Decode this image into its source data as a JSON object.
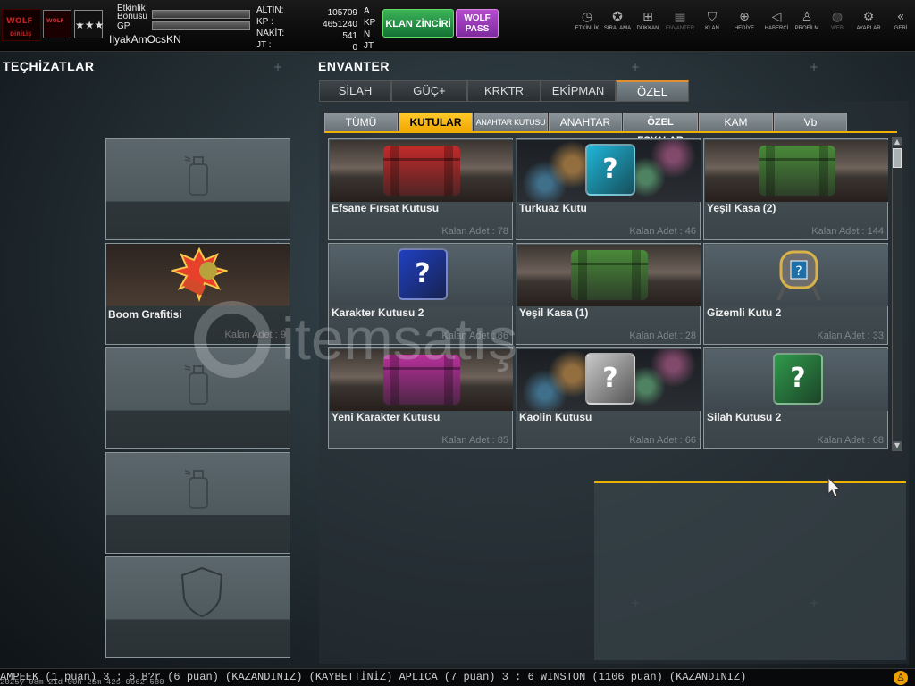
{
  "topbar": {
    "logo_text": "WOLF",
    "logo_sub": "DİRİLİŞ",
    "badge_text": "WOLF",
    "rank_glyph": "★★★",
    "event_bonus_label_1": "Etkinlik",
    "event_bonus_label_2": "Bonusu",
    "gp_label": "GP",
    "username": "IlyakAmOcsKN",
    "currencies": [
      {
        "label": "ALTIN:",
        "value": "105709",
        "unit": "A"
      },
      {
        "label": "KP  :",
        "value": "4651240",
        "unit": "KP"
      },
      {
        "label": "NAKİT:",
        "value": "541",
        "unit": "N"
      },
      {
        "label": "JT  :",
        "value": "0",
        "unit": "JT"
      }
    ],
    "klan_button": "KLAN ZİNCİRİ",
    "wolf_pass_line1": "WOLF",
    "wolf_pass_line2": "PASS",
    "nav": [
      {
        "label": "ETKİNLİK",
        "icon": "clock-icon",
        "glyph": "◷"
      },
      {
        "label": "SIRALAMA",
        "icon": "medal-icon",
        "glyph": "✪"
      },
      {
        "label": "DÜKKAN",
        "icon": "cart-icon",
        "glyph": "⊞"
      },
      {
        "label": "ENVANTER",
        "icon": "inventory-icon",
        "glyph": "▦"
      },
      {
        "label": "KLAN",
        "icon": "shield-icon",
        "glyph": "⛉"
      },
      {
        "label": "HEDİYE",
        "icon": "gift-icon",
        "glyph": "⊕"
      },
      {
        "label": "HABERCİ",
        "icon": "megaphone-icon",
        "glyph": "◁"
      },
      {
        "label": "PROFİLM",
        "icon": "profile-icon",
        "glyph": "♙"
      },
      {
        "label": "WEB",
        "icon": "globe-icon",
        "glyph": "◍"
      },
      {
        "label": "AYARLAR",
        "icon": "gear-icon",
        "glyph": "⚙"
      },
      {
        "label": "GERİ",
        "icon": "back-icon",
        "glyph": "«"
      }
    ]
  },
  "equipment": {
    "title": "TEÇHİZATLAR",
    "slots": [
      {
        "name": "",
        "count": "",
        "icon": "spray-can-icon"
      },
      {
        "name": "Boom Grafitisi",
        "count": "Kalan Adet : 9",
        "icon": "boom-graffiti-icon"
      },
      {
        "name": "",
        "count": "",
        "icon": "spray-can-icon"
      },
      {
        "name": "",
        "count": "",
        "icon": "spray-can-icon"
      },
      {
        "name": "",
        "count": "",
        "icon": "shield-icon"
      }
    ]
  },
  "inventory": {
    "title": "ENVANTER",
    "main_tabs": [
      "SİLAH",
      "GÜÇ+",
      "KRKTR",
      "EKİPMAN",
      "ÖZEL"
    ],
    "active_main_tab": "ÖZEL",
    "sub_tabs": [
      "TÜMÜ",
      "KUTULAR",
      "ANAHTAR KUTUSU",
      "ANAHTAR",
      "ÖZEL EŞYALAR",
      "KAM",
      "Vb"
    ],
    "active_sub_tab": "KUTULAR",
    "items": [
      {
        "name": "Efsane Fırsat Kutusu",
        "count": "Kalan Adet : 78",
        "icon": "red-crate-icon",
        "color": "#c42a2a"
      },
      {
        "name": "Turkuaz Kutu",
        "count": "Kalan Adet : 46",
        "icon": "turquoise-box-icon",
        "color": "#1fb6d8"
      },
      {
        "name": "Yeşil Kasa (2)",
        "count": "Kalan Adet : 144",
        "icon": "green-crate-icon",
        "color": "#4a8a3a"
      },
      {
        "name": "Karakter Kutusu 2",
        "count": "Kalan Adet : 86",
        "icon": "blue-character-box-icon",
        "color": "#2040c0"
      },
      {
        "name": "Yeşil Kasa (1)",
        "count": "Kalan Adet : 28",
        "icon": "green-crate-icon",
        "color": "#4a8a3a"
      },
      {
        "name": "Gizemli Kutu 2",
        "count": "Kalan Adet : 33",
        "icon": "mystery-box-icon",
        "color": "#8a8a8a"
      },
      {
        "name": "Yeni Karakter Kutusu",
        "count": "Kalan Adet : 85",
        "icon": "pink-crate-icon",
        "color": "#b8309c"
      },
      {
        "name": "Kaolin Kutusu",
        "count": "Kalan Adet : 66",
        "icon": "white-box-icon",
        "color": "#c8c8c8"
      },
      {
        "name": "Silah Kutusu 2",
        "count": "Kalan Adet : 68",
        "icon": "green-weapon-box-icon",
        "color": "#2f9a4c"
      }
    ]
  },
  "watermark": "itemsatış",
  "ticker": "AMPEEK (1 puan) 3 : 6 B?r (6 puan) (KAZANDINIZ)     (KAYBETTİNİZ) APLICA (7 puan) 3 : 6 WINSTON (1106 puan) (KAZANDINIZ)",
  "ticker_timestamp": "2025y-08m-21d-00h-25m-42s-0962-680"
}
